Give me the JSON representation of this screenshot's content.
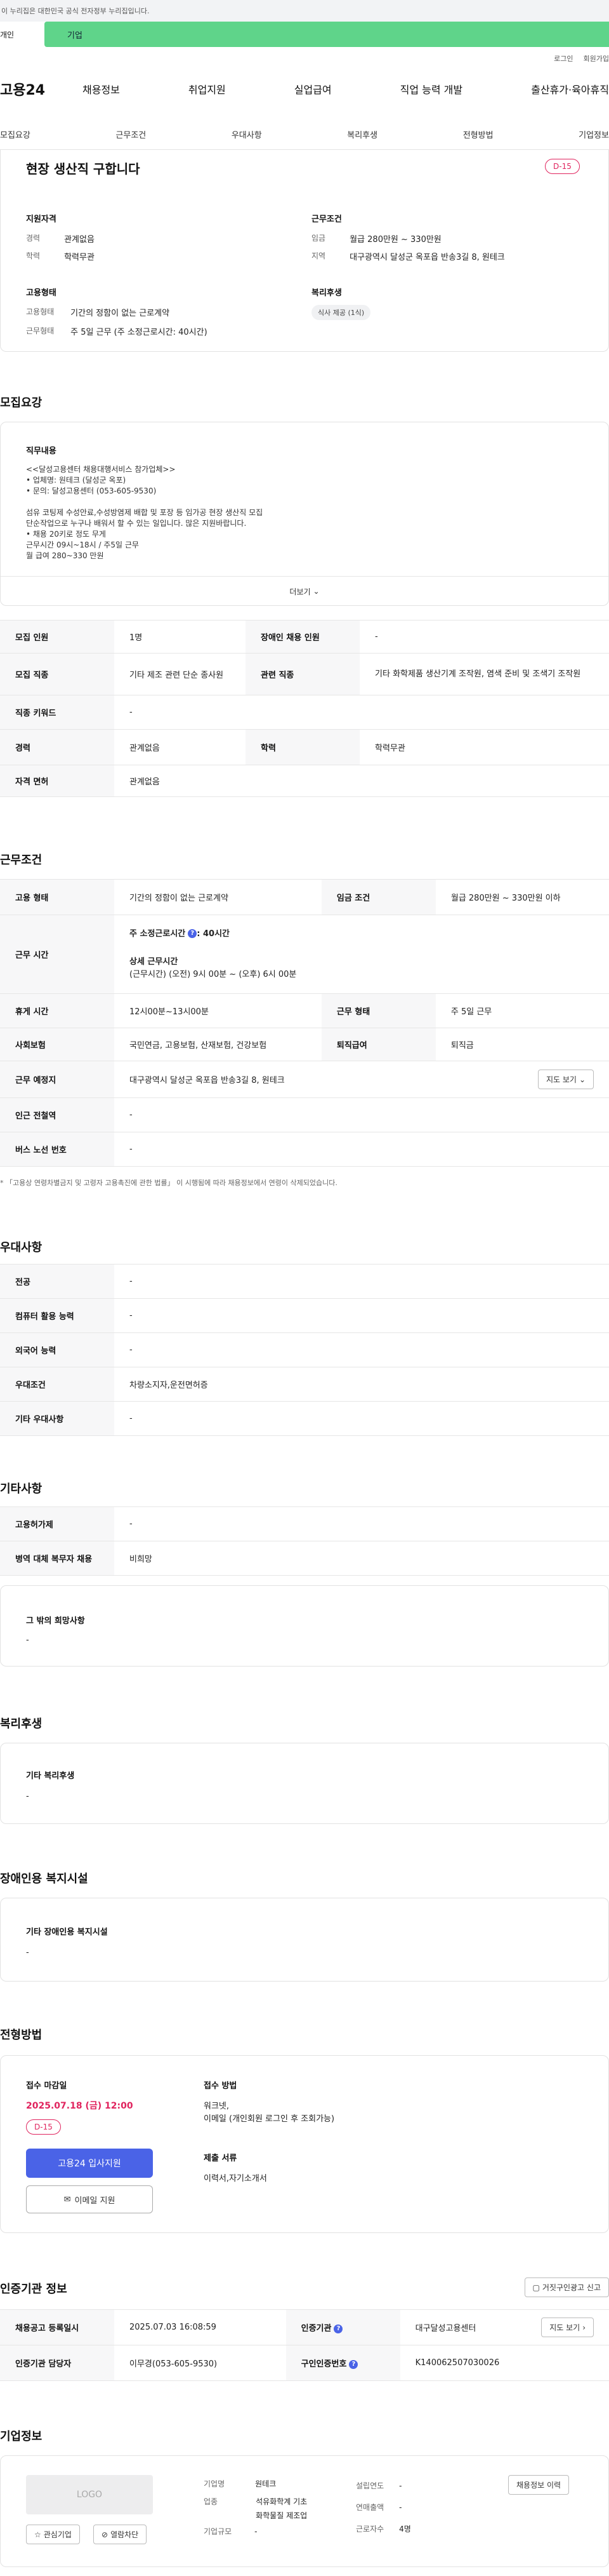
{
  "gov_banner": "이 누리집은 대한민국 공식 전자정부 누리집입니다.",
  "mode": {
    "left": "개인",
    "right": "기업"
  },
  "util": {
    "login": "로그인",
    "join": "회원가입"
  },
  "gnb": {
    "logo": "고용24",
    "menu": [
      "채용정보",
      "취업지원",
      "실업급여",
      "직업 능력 개발",
      "출산휴가·육아휴직"
    ]
  },
  "subnav": [
    "모집요강",
    "근무조건",
    "우대사항",
    "복리후생",
    "전형방법",
    "기업정보"
  ],
  "header": {
    "title": "현장 생산직 구합니다",
    "dday": "D-15",
    "qual_title": "지원자격",
    "qual": [
      {
        "k": "경력",
        "v": "관계없음"
      },
      {
        "k": "학력",
        "v": "학력무관"
      }
    ],
    "cond_title": "근무조건",
    "cond": [
      {
        "k": "임금",
        "v": "월급 280만원 ~ 330만원"
      },
      {
        "k": "지역",
        "v": "대구광역시 달성군 옥포읍 반송3길 8, 원테크"
      }
    ],
    "emp_title": "고용형태",
    "emp": [
      {
        "k": "고용형태",
        "v": "기간의 정함이 없는 근로계약"
      },
      {
        "k": "근무형태",
        "v": "주 5일 근무 (주 소정근로시간: 40시간)"
      }
    ],
    "welfare_title": "복리후생",
    "welfare_chip": "식사 제공 (1식)"
  },
  "recruit": {
    "section_title": "모집요강",
    "job_title": "직무내용",
    "job_lines": [
      "<<달성고용센터 채용대행서비스 참가업체>>",
      "• 업체명: 원테크 (달성군 옥포)",
      "• 문의: 달성고용센터 (053-605-9530)",
      "",
      "섬유 코팅제 수성안료,수성방염제 배합 및 포장 등 임가공 현장 생산직 모집",
      "단순작업으로 누구나 배워서 할 수 있는 일입니다. 많은 지원바랍니다.",
      "• 채용 20키로 정도 무게",
      "근무시간 09시~18시 / 주5일 근무",
      "월 급여 280~330 만원"
    ],
    "more": "더보기",
    "rows": [
      {
        "k1": "모집 인원",
        "v1": "1명",
        "k2": "장애인 채용 인원",
        "v2": "-"
      },
      {
        "k1": "모집 직종",
        "v1": "기타 제조 관련 단순 종사원",
        "k2": "관련 직종",
        "v2": "기타 화학제품 생산기계 조작원, 염색 준비 및 조색기 조작원"
      },
      {
        "k1": "직종 키워드",
        "v1": "-"
      },
      {
        "k1": "경력",
        "v1": "관계없음",
        "k2": "학력",
        "v2": "학력무관"
      },
      {
        "k1": "자격 면허",
        "v1": "관계없음"
      }
    ]
  },
  "work": {
    "section_title": "근무조건",
    "employ_type_k": "고용 형태",
    "employ_type_v": "기간의 정함이 없는 근로계약",
    "wage_k": "임금 조건",
    "wage_v": "월급 280만원 ~ 330만원 이하",
    "hours_k": "근무 시간",
    "hours_main": "주 소정근로시간",
    "hours_main_val": ": 40시간",
    "hours_detail_title": "상세 근무시간",
    "hours_detail": "(근무시간) (오전) 9시 00분 ~ (오후) 6시 00분",
    "rest_k": "휴게 시간",
    "rest_v": "12시00분~13시00분",
    "form_k": "근무 형태",
    "form_v": "주 5일 근무",
    "ins_k": "사회보험",
    "ins_v": "국민연금, 고용보험, 산재보험, 건강보험",
    "sev_k": "퇴직급여",
    "sev_v": "퇴직금",
    "place_k": "근무 예정지",
    "place_v": "대구광역시 달성군 옥포읍 반송3길 8, 원테크",
    "map_btn": "지도 보기",
    "subway_k": "인근 전철역",
    "subway_v": "-",
    "bus_k": "버스 노선 번호",
    "bus_v": "-",
    "note": "* 「고용상 연령차별금지 및 고령자 고용촉진에 관한 법률」 이 시행됨에 따라 채용정보에서 연령이 삭제되었습니다."
  },
  "pref": {
    "section_title": "우대사항",
    "rows": [
      {
        "k": "전공",
        "v": "-"
      },
      {
        "k": "컴퓨터 활용 능력",
        "v": "-"
      },
      {
        "k": "외국어 능력",
        "v": "-"
      },
      {
        "k": "우대조건",
        "v": "차량소지자,운전면허증"
      },
      {
        "k": "기타 우대사항",
        "v": "-"
      }
    ]
  },
  "etc": {
    "section_title": "기타사항",
    "rows": [
      {
        "k": "고용허가제",
        "v": "-"
      },
      {
        "k": "병역 대체 복무자 채용",
        "v": "비희망"
      }
    ],
    "other_title": "그 밖의 희망사항",
    "other_v": "-"
  },
  "welfare": {
    "section_title": "복리후생",
    "box_title": "기타 복리후생",
    "box_v": "-"
  },
  "disab": {
    "section_title": "장애인용 복지시설",
    "box_title": "기타 장애인용 복지시설",
    "box_v": "-"
  },
  "selection": {
    "section_title": "전형방법",
    "deadline_title": "접수 마감일",
    "deadline": "2025.07.18 (금) 12:00",
    "dday": "D-15",
    "apply_btn": "고용24 입사지원",
    "email_btn": "이메일 지원",
    "method_title": "접수 방법",
    "method_lines": [
      "워크넷,",
      "이메일 (개인회원 로그인 후 조회가능)"
    ],
    "docs_title": "제출 서류",
    "docs_v": "이력서,자기소개서"
  },
  "agency": {
    "section_title": "인증기관 정보",
    "report_btn": "거짓구인광고 신고",
    "rows": [
      {
        "k1": "채용공고 등록일시",
        "v1": "2025.07.03 16:08:59",
        "k2": "인증기관",
        "v2": "대구달성고용센터",
        "btn": "지도 보기"
      },
      {
        "k1": "인증기관 담당자",
        "v1": "이무경(053-605-9530)",
        "k2": "구인인증번호",
        "v2": "K140062507030026"
      }
    ]
  },
  "company": {
    "section_title": "기업정보",
    "logo": "LOGO",
    "fav_btn": "관심기업",
    "block_btn": "열람차단",
    "name_k": "기업명",
    "name_v": "원테크",
    "industry_k": "업종",
    "industry_v": [
      "석유화학계 기초",
      "화학물질 제조업"
    ],
    "scale_k": "기업규모",
    "scale_v": "-",
    "founded_k": "설립연도",
    "founded_v": "-",
    "sales_k": "연매출액",
    "sales_v": "-",
    "workers_k": "근로자수",
    "workers_v": "4명",
    "jobs_btn": "채용정보 이력"
  }
}
